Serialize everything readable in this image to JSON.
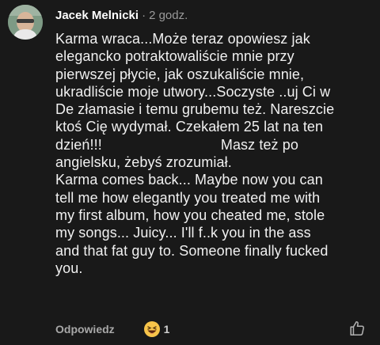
{
  "comment": {
    "author": "Jacek Melnicki",
    "separator": "·",
    "time": "2 godz.",
    "lines": [
      "Karma wraca...Może teraz opowiesz jak",
      "elegancko potraktowaliście mnie przy",
      "pierwszej płycie, jak oszukaliście mnie,",
      "ukradliście moje utwory...Soczyste ..uj Ci w",
      "De złamasie i temu grubemu też. Nareszcie",
      "ktoś Cię wydymał. Czekałem 25 lat na ten",
      "dzień!!!",
      "Masz też po",
      "angielsku, żebyś zrozumiał.",
      "Karma comes back... Maybe now you can",
      "tell me how elegantly you treated me with",
      "my first album, how you cheated me, stole",
      "my songs... Juicy... I'll f..k you in the ass",
      "and that fat guy to. Someone finally fucked",
      "you."
    ]
  },
  "actions": {
    "reply_label": "Odpowiedz",
    "reaction_icon": "laughing-emoji-icon",
    "reaction_count": "1",
    "like_icon": "thumbs-up-icon"
  },
  "colors": {
    "background": "#191919",
    "text": "#f0f0f0",
    "muted": "#a8a8a8",
    "emoji": "#f7c44a"
  }
}
